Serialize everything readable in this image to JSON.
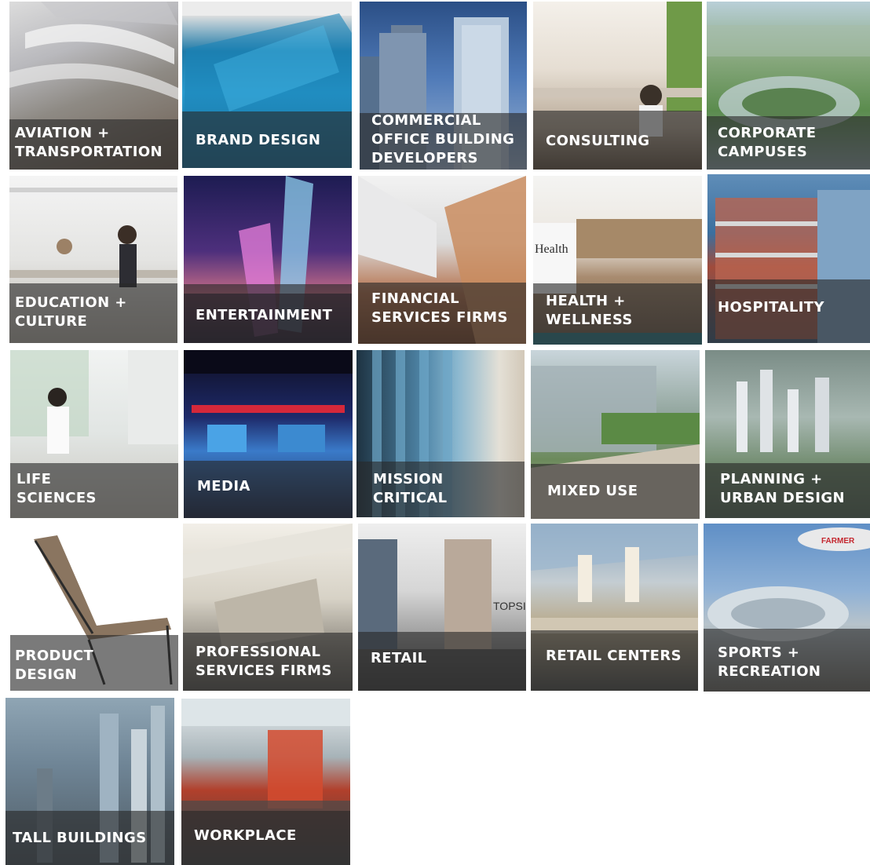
{
  "tiles": [
    {
      "label": "AVIATION +\nTRANSPORTATION"
    },
    {
      "label": "BRAND DESIGN"
    },
    {
      "label": "COMMERCIAL\nOFFICE BUILDING\nDEVELOPERS"
    },
    {
      "label": "CONSULTING"
    },
    {
      "label": "CORPORATE\nCAMPUSES"
    },
    {
      "label": "EDUCATION +\nCULTURE"
    },
    {
      "label": "ENTERTAINMENT"
    },
    {
      "label": "FINANCIAL\nSERVICES FIRMS"
    },
    {
      "label": "HEALTH +\nWELLNESS"
    },
    {
      "label": "HOSPITALITY"
    },
    {
      "label": "LIFE\nSCIENCES"
    },
    {
      "label": "MEDIA"
    },
    {
      "label": "MISSION\nCRITICAL"
    },
    {
      "label": "MIXED USE"
    },
    {
      "label": "PLANNING +\nURBAN DESIGN"
    },
    {
      "label": "PRODUCT\nDESIGN"
    },
    {
      "label": "PROFESSIONAL\nSERVICES FIRMS"
    },
    {
      "label": "RETAIL"
    },
    {
      "label": "RETAIL CENTERS"
    },
    {
      "label": "SPORTS +\nRECREATION"
    },
    {
      "label": "TALL BUILDINGS"
    },
    {
      "label": "WORKPLACE"
    }
  ]
}
